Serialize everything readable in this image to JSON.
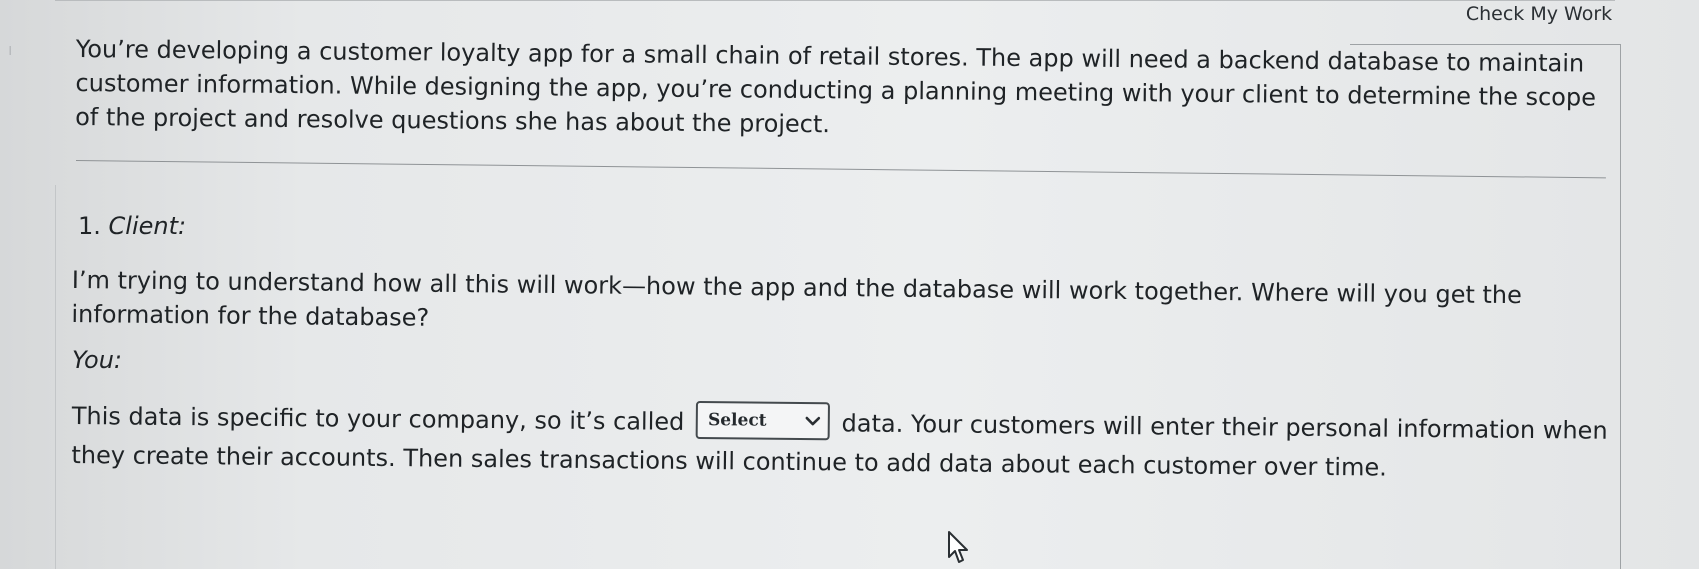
{
  "header": {
    "check_button_label": "Check My Work"
  },
  "intro": {
    "text": "You’re developing a customer loyalty app for a small chain of retail stores. The app will need a backend database to maintain customer information. While designing the app, you’re conducting a planning meeting with your client to determine the scope of the project and resolve questions she has about the project."
  },
  "question": {
    "number": "1.",
    "speaker": "Client:",
    "client_text": "I’m trying to understand how all this will work—how the app and the database will work together. Where will you get the information for the database?",
    "you_label": "You:",
    "answer_before": "This data is specific to your company, so it’s called",
    "select_value": "Select",
    "answer_after": "data. Your customers will enter their personal information when they create their accounts. Then sales transactions will continue to add data about each customer over time."
  },
  "icons": {
    "dropdown": "chevron-down-icon",
    "cursor": "mouse-pointer-icon"
  },
  "colors": {
    "background": "#e8eaeb",
    "text": "#1f2326",
    "border": "#444a4e"
  }
}
